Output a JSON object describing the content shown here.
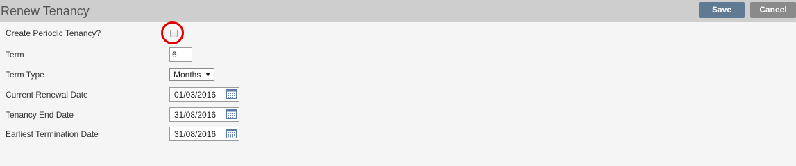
{
  "header": {
    "title": "Renew Tenancy",
    "save_label": "Save",
    "cancel_label": "Cancel"
  },
  "form": {
    "periodic": {
      "label": "Create Periodic Tenancy?",
      "checked": false
    },
    "term": {
      "label": "Term",
      "value": "6"
    },
    "term_type": {
      "label": "Term Type",
      "selected": "Months"
    },
    "current_renewal_date": {
      "label": "Current Renewal Date",
      "value": "01/03/2016"
    },
    "tenancy_end_date": {
      "label": "Tenancy End Date",
      "value": "31/08/2016"
    },
    "earliest_termination_date": {
      "label": "Earliest Termination Date",
      "value": "31/08/2016"
    }
  },
  "icons": {
    "calendar": "calendar-icon",
    "dropdown": "triangle-down-icon"
  },
  "colors": {
    "header_bg": "#cecece",
    "save_bg": "#607a94",
    "cancel_bg": "#8a8a8a",
    "highlight": "#e00000",
    "page_bg": "#f5f5f5"
  }
}
